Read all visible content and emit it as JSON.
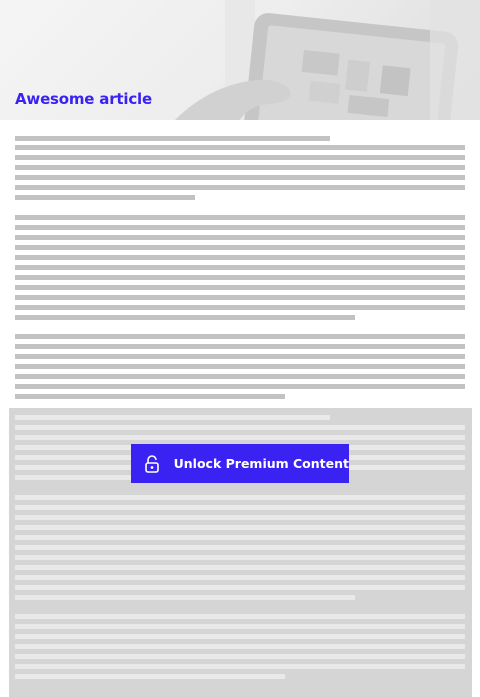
{
  "article": {
    "title": "Awesome article"
  },
  "hero": {
    "image": "tablet-hand-photo"
  },
  "paywall": {
    "unlock_label": "Unlock Premium Content",
    "icon": "unlock-padlock-icon"
  },
  "colors": {
    "accent": "#3a22f2",
    "text_placeholder": "#c2c2c2",
    "locked_overlay": "#d5d5d5",
    "locked_placeholder": "#e9e9e9"
  }
}
